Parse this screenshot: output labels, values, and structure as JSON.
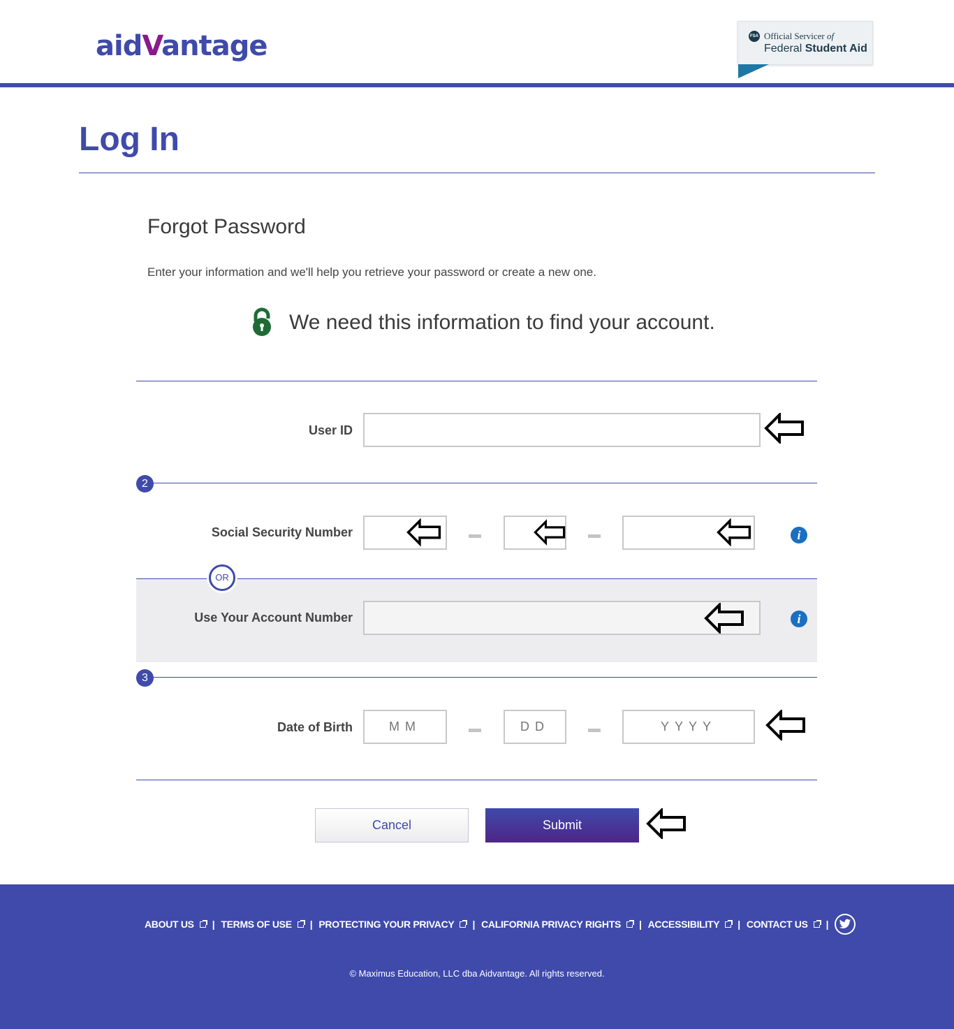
{
  "header": {
    "logo_prefix": "aid",
    "logo_v": "V",
    "logo_suffix": "antage",
    "fsa_badge": {
      "circle_text": "FSA",
      "line1_a": "Official Servicer ",
      "line1_b": "of",
      "line2_a": "Federal",
      "line2_b": "Student Aid"
    }
  },
  "page": {
    "title": "Log In",
    "section_title": "Forgot Password",
    "intro": "Enter your information and we'll help you retrieve your password or create a new one.",
    "notice": "We need this information to find your account."
  },
  "form": {
    "user_id": {
      "label": "User ID",
      "value": "",
      "placeholder": ""
    },
    "step2_badge": "2",
    "ssn": {
      "label": "Social Security Number",
      "part1": "",
      "part2": "",
      "part3": ""
    },
    "or_label": "OR",
    "account_number": {
      "label": "Use Your Account Number",
      "value": ""
    },
    "step3_badge": "3",
    "dob": {
      "label": "Date of Birth",
      "month_placeholder": "MM",
      "day_placeholder": "DD",
      "year_placeholder": "YYYY"
    }
  },
  "buttons": {
    "cancel": "Cancel",
    "submit": "Submit"
  },
  "footer": {
    "links": [
      {
        "label": "ABOUT US"
      },
      {
        "label": "TERMS OF USE"
      },
      {
        "label": "PROTECTING YOUR PRIVACY"
      },
      {
        "label": "CALIFORNIA PRIVACY RIGHTS"
      },
      {
        "label": "ACCESSIBILITY"
      },
      {
        "label": "CONTACT US"
      }
    ],
    "separator": "|",
    "copyright": "© Maximus Education, LLC dba Aidvantage. All rights reserved."
  },
  "colors": {
    "brand": "#3f4aab",
    "logo_accent": "#8a1a8c",
    "lock": "#1e6b36",
    "info": "#1a6fc1",
    "submit_gradient_end": "#4e2587"
  }
}
